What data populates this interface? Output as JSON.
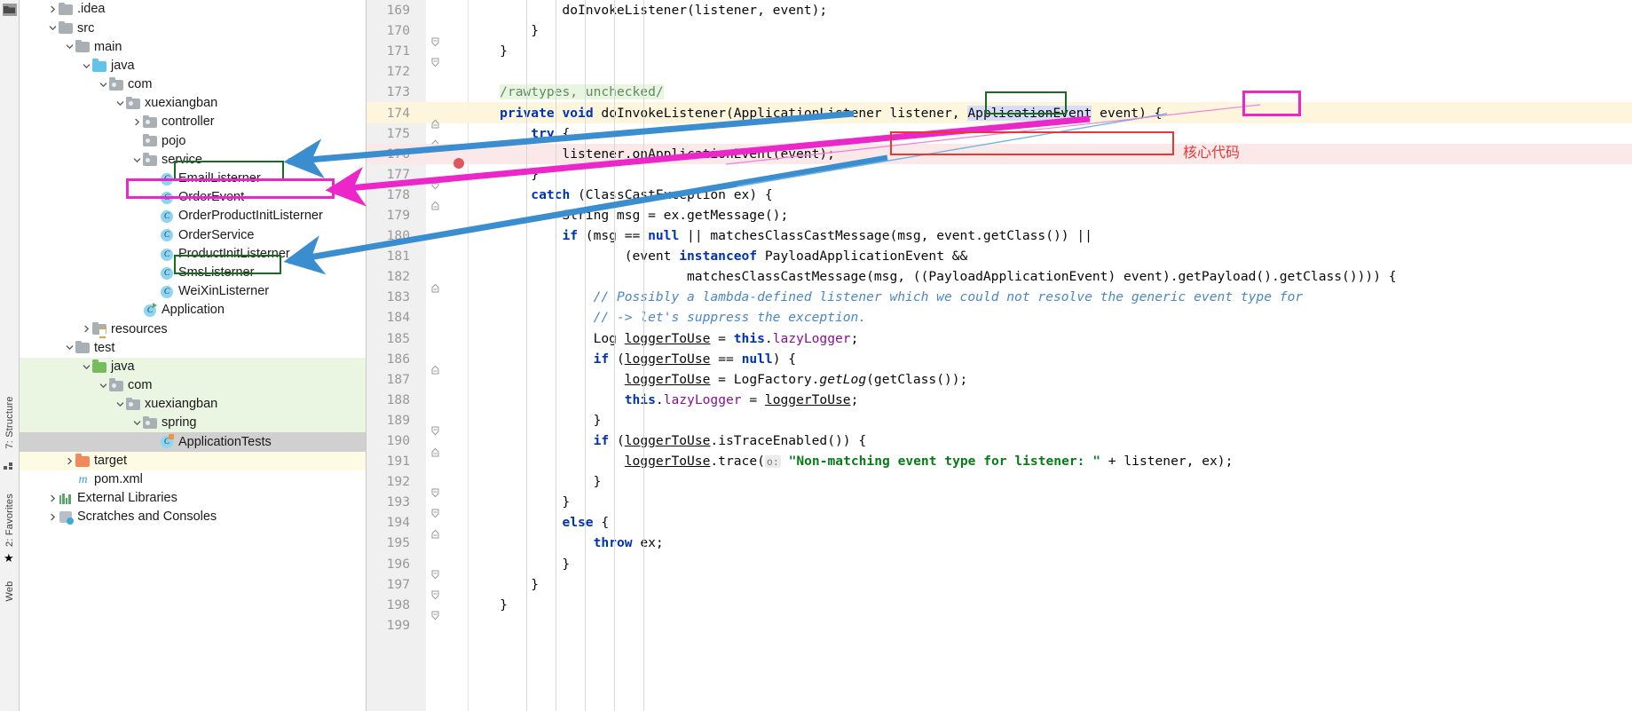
{
  "toolwindows": {
    "structure_tab": "7: Structure",
    "favorites_tab": "2: Favorites",
    "web_tab": "Web"
  },
  "project_tree": {
    "items": [
      {
        "label": ".idea",
        "indent": 1,
        "arrow": "chevron-right",
        "icon": "folder-grey",
        "row_bg": "none"
      },
      {
        "label": "src",
        "indent": 1,
        "arrow": "chevron-down",
        "icon": "folder-grey",
        "row_bg": "none"
      },
      {
        "label": "main",
        "indent": 2,
        "arrow": "chevron-down",
        "icon": "folder-grey",
        "row_bg": "none"
      },
      {
        "label": "java",
        "indent": 3,
        "arrow": "chevron-down",
        "icon": "folder-blue",
        "row_bg": "none"
      },
      {
        "label": "com",
        "indent": 4,
        "arrow": "chevron-down",
        "icon": "folder-package",
        "row_bg": "none"
      },
      {
        "label": "xuexiangban",
        "indent": 5,
        "arrow": "chevron-down",
        "icon": "folder-package",
        "row_bg": "none"
      },
      {
        "label": "controller",
        "indent": 6,
        "arrow": "chevron-right",
        "icon": "folder-package",
        "row_bg": "none"
      },
      {
        "label": "pojo",
        "indent": 6,
        "arrow": "none",
        "icon": "folder-package",
        "row_bg": "none"
      },
      {
        "label": "service",
        "indent": 6,
        "arrow": "chevron-down",
        "icon": "folder-package",
        "row_bg": "none"
      },
      {
        "label": "EmailListerner",
        "indent": 7,
        "arrow": "none",
        "icon": "class",
        "row_bg": "none"
      },
      {
        "label": "OrderEvent",
        "indent": 7,
        "arrow": "none",
        "icon": "class",
        "row_bg": "none"
      },
      {
        "label": "OrderProductInitListerner",
        "indent": 7,
        "arrow": "none",
        "icon": "class",
        "row_bg": "none"
      },
      {
        "label": "OrderService",
        "indent": 7,
        "arrow": "none",
        "icon": "class",
        "row_bg": "none"
      },
      {
        "label": "ProductInitListerner",
        "indent": 7,
        "arrow": "none",
        "icon": "class",
        "row_bg": "none"
      },
      {
        "label": "SmsListerner",
        "indent": 7,
        "arrow": "none",
        "icon": "class",
        "row_bg": "none"
      },
      {
        "label": "WeiXinListerner",
        "indent": 7,
        "arrow": "none",
        "icon": "class",
        "row_bg": "none"
      },
      {
        "label": "Application",
        "indent": 6,
        "arrow": "none",
        "icon": "class-runnable",
        "row_bg": "none"
      },
      {
        "label": "resources",
        "indent": 3,
        "arrow": "chevron-right",
        "icon": "folder-resources",
        "row_bg": "none"
      },
      {
        "label": "test",
        "indent": 2,
        "arrow": "chevron-down",
        "icon": "folder-grey",
        "row_bg": "none"
      },
      {
        "label": "java",
        "indent": 3,
        "arrow": "chevron-down",
        "icon": "folder-green",
        "row_bg": "green"
      },
      {
        "label": "com",
        "indent": 4,
        "arrow": "chevron-down",
        "icon": "folder-package",
        "row_bg": "green"
      },
      {
        "label": "xuexiangban",
        "indent": 5,
        "arrow": "chevron-down",
        "icon": "folder-package",
        "row_bg": "green"
      },
      {
        "label": "spring",
        "indent": 6,
        "arrow": "chevron-down",
        "icon": "folder-package",
        "row_bg": "green"
      },
      {
        "label": "ApplicationTests",
        "indent": 7,
        "arrow": "none",
        "icon": "class-test",
        "row_bg": "grey"
      },
      {
        "label": "target",
        "indent": 2,
        "arrow": "chevron-right",
        "icon": "folder-orange",
        "row_bg": "yellow"
      },
      {
        "label": "pom.xml",
        "indent": 2,
        "arrow": "none",
        "icon": "maven",
        "row_bg": "none"
      },
      {
        "label": "External Libraries",
        "indent": 1,
        "arrow": "chevron-right",
        "icon": "libraries",
        "row_bg": "none"
      },
      {
        "label": "Scratches and Consoles",
        "indent": 1,
        "arrow": "chevron-right",
        "icon": "scratches",
        "row_bg": "none"
      }
    ]
  },
  "annotations": {
    "core_code_label": "核心代码",
    "box_colors": {
      "green": "#1a6b1f",
      "magenta": "#ec27c9",
      "red": "#e53935",
      "blue_arrow": "#3a8ed0"
    }
  },
  "editor": {
    "first_line_number": 169,
    "last_line_number": 199,
    "lines": [
      {
        "n": 169,
        "indent": 0,
        "bg": "none",
        "fold": "none",
        "bp": false
      },
      {
        "n": 170,
        "indent": 0,
        "bg": "none",
        "fold": "end",
        "bp": false
      },
      {
        "n": 171,
        "indent": 0,
        "bg": "none",
        "fold": "end",
        "bp": false
      },
      {
        "n": 172,
        "indent": 0,
        "bg": "none",
        "fold": "none",
        "bp": false
      },
      {
        "n": 173,
        "indent": 0,
        "bg": "none",
        "fold": "none",
        "bp": false
      },
      {
        "n": 174,
        "indent": 0,
        "bg": "yellow",
        "fold": "start",
        "bp": false
      },
      {
        "n": 175,
        "indent": 0,
        "bg": "none",
        "fold": "start",
        "bp": false
      },
      {
        "n": 176,
        "indent": 0,
        "bg": "red",
        "fold": "none",
        "bp": true
      },
      {
        "n": 177,
        "indent": 0,
        "bg": "none",
        "fold": "end",
        "bp": false
      },
      {
        "n": 178,
        "indent": 0,
        "bg": "none",
        "fold": "start",
        "bp": false
      },
      {
        "n": 179,
        "indent": 0,
        "bg": "none",
        "fold": "none",
        "bp": false
      },
      {
        "n": 180,
        "indent": 0,
        "bg": "none",
        "fold": "none",
        "bp": false
      },
      {
        "n": 181,
        "indent": 0,
        "bg": "none",
        "fold": "none",
        "bp": false
      },
      {
        "n": 182,
        "indent": 0,
        "bg": "none",
        "fold": "start",
        "bp": false
      },
      {
        "n": 183,
        "indent": 0,
        "bg": "none",
        "fold": "none",
        "bp": false
      },
      {
        "n": 184,
        "indent": 0,
        "bg": "none",
        "fold": "none",
        "bp": false
      },
      {
        "n": 185,
        "indent": 0,
        "bg": "none",
        "fold": "none",
        "bp": false
      },
      {
        "n": 186,
        "indent": 0,
        "bg": "none",
        "fold": "start",
        "bp": false
      },
      {
        "n": 187,
        "indent": 0,
        "bg": "none",
        "fold": "none",
        "bp": false
      },
      {
        "n": 188,
        "indent": 0,
        "bg": "none",
        "fold": "none",
        "bp": false
      },
      {
        "n": 189,
        "indent": 0,
        "bg": "none",
        "fold": "end",
        "bp": false
      },
      {
        "n": 190,
        "indent": 0,
        "bg": "none",
        "fold": "start",
        "bp": false
      },
      {
        "n": 191,
        "indent": 0,
        "bg": "none",
        "fold": "none",
        "bp": false
      },
      {
        "n": 192,
        "indent": 0,
        "bg": "none",
        "fold": "end",
        "bp": false
      },
      {
        "n": 193,
        "indent": 0,
        "bg": "none",
        "fold": "end",
        "bp": false
      },
      {
        "n": 194,
        "indent": 0,
        "bg": "none",
        "fold": "start",
        "bp": false
      },
      {
        "n": 195,
        "indent": 0,
        "bg": "none",
        "fold": "none",
        "bp": false
      },
      {
        "n": 196,
        "indent": 0,
        "bg": "none",
        "fold": "end",
        "bp": false
      },
      {
        "n": 197,
        "indent": 0,
        "bg": "none",
        "fold": "end",
        "bp": false
      },
      {
        "n": 198,
        "indent": 0,
        "bg": "none",
        "fold": "end",
        "bp": false
      },
      {
        "n": 199,
        "indent": 0,
        "bg": "none",
        "fold": "none",
        "bp": false
      }
    ],
    "code_text": {
      "l169": "            doInvokeListener(listener, event);",
      "l170": "        }",
      "l171": "    }",
      "l172": "",
      "l173": "    /rawtypes, unchecked/",
      "l174": "    private void doInvokeListener(ApplicationListener listener, ApplicationEvent event) {",
      "l175": "        try {",
      "l176": "            listener.onApplicationEvent(event);",
      "l177": "        }",
      "l178": "        catch (ClassCastException ex) {",
      "l179": "            String msg = ex.getMessage();",
      "l180": "            if (msg == null || matchesClassCastMessage(msg, event.getClass()) ||",
      "l181": "                    (event instanceof PayloadApplicationEvent &&",
      "l182": "                            matchesClassCastMessage(msg, ((PayloadApplicationEvent) event).getPayload().getClass()))) {",
      "l183": "                // Possibly a lambda-defined listener which we could not resolve the generic event type for",
      "l184": "                // -> let's suppress the exception.",
      "l185": "                Log loggerToUse = this.lazyLogger;",
      "l186": "                if (loggerToUse == null) {",
      "l187": "                    loggerToUse = LogFactory.getLog(getClass());",
      "l188": "                    this.lazyLogger = loggerToUse;",
      "l189": "                }",
      "l190": "                if (loggerToUse.isTraceEnabled()) {",
      "l191": "                    loggerToUse.trace( o: \"Non-matching event type for listener: \" + listener, ex);",
      "l192": "                }",
      "l193": "            }",
      "l194": "            else {",
      "l195": "                throw ex;",
      "l196": "            }",
      "l197": "        }",
      "l198": "    }",
      "l199": ""
    },
    "param_hint_label": "o:"
  }
}
